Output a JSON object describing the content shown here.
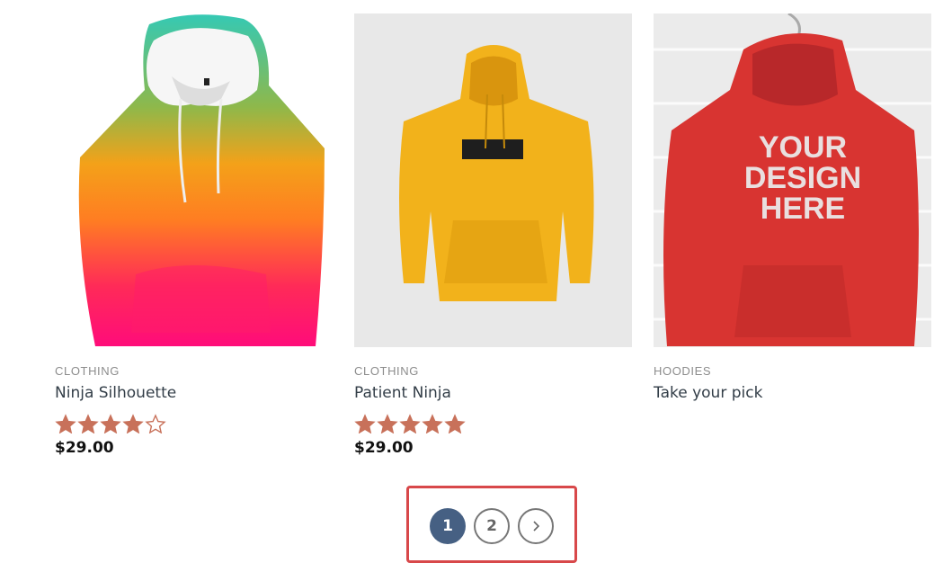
{
  "products": [
    {
      "category": "CLOTHING",
      "title": "Ninja Silhouette",
      "rating": 4,
      "price": "$29.00",
      "image_icon": "gradient-hoodie-image"
    },
    {
      "category": "CLOTHING",
      "title": "Patient Ninja",
      "rating": 5,
      "price": "$29.00",
      "image_icon": "yellow-hoodie-image"
    },
    {
      "category": "HOODIES",
      "title": "Take your pick",
      "image_text": [
        "YOUR",
        "DESIGN",
        "HERE"
      ],
      "image_icon": "red-hoodie-image"
    }
  ],
  "pagination": {
    "current_page": "1",
    "pages": [
      "1",
      "2"
    ],
    "next_icon": "chevron-right-icon"
  },
  "colors": {
    "star": "#c8715a",
    "current_page_bg": "#466083",
    "highlight_border": "#d8484a"
  }
}
